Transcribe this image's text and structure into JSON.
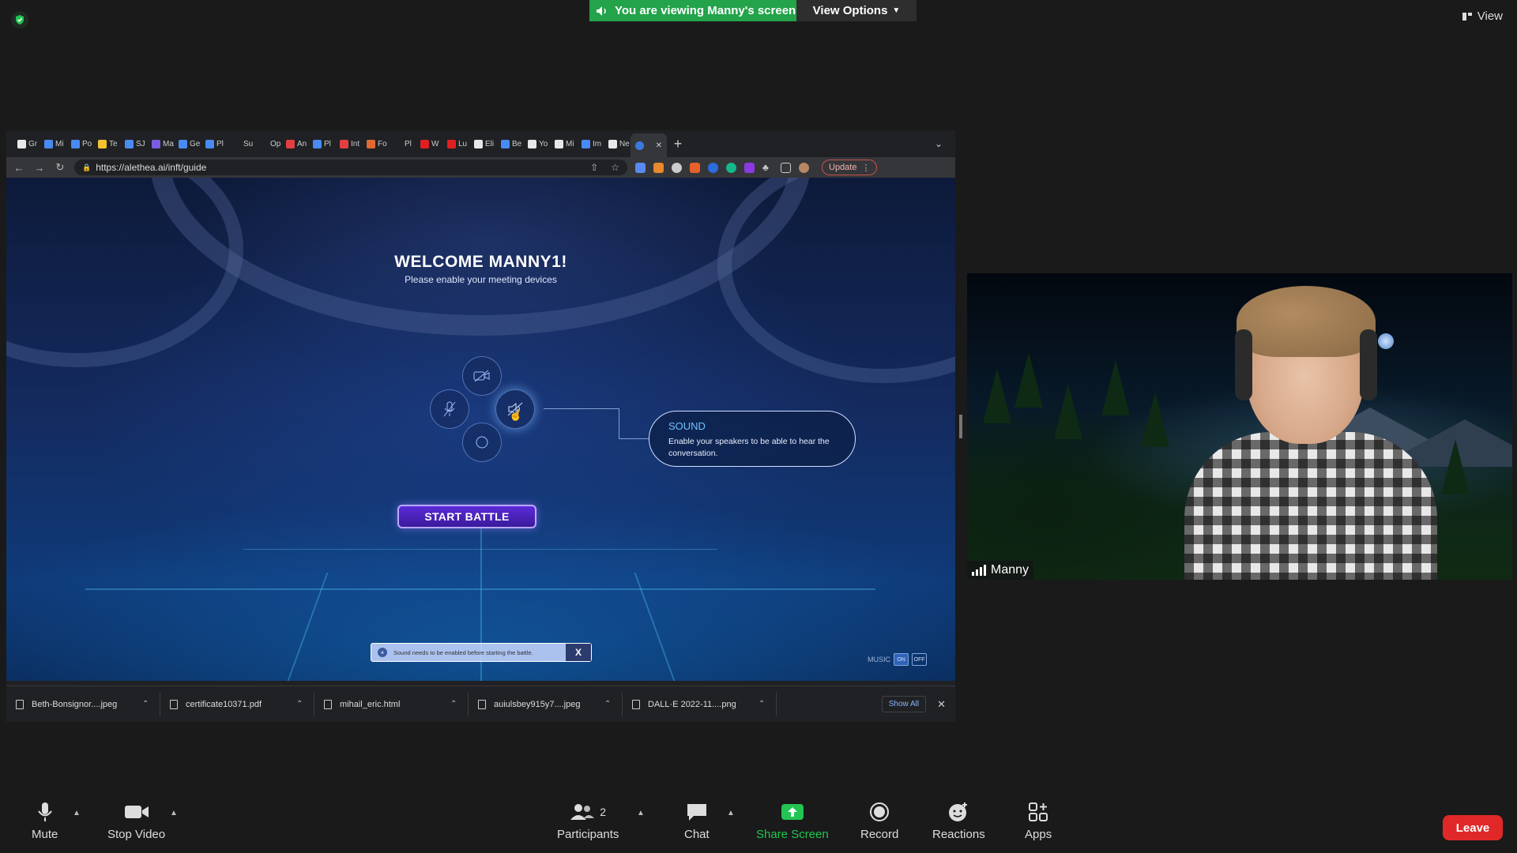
{
  "zoom": {
    "banner": "You are viewing Manny's screen",
    "view_options": "View Options",
    "view": "View",
    "participant_name": "Manny",
    "participant_count": "2",
    "toolbar": {
      "mute": "Mute",
      "stop_video": "Stop Video",
      "participants": "Participants",
      "chat": "Chat",
      "share_screen": "Share Screen",
      "record": "Record",
      "reactions": "Reactions",
      "apps": "Apps",
      "leave": "Leave"
    },
    "colors": {
      "banner": "#23a34a",
      "leave": "#e02828",
      "share": "#23c552"
    }
  },
  "browser": {
    "tabs": [
      {
        "label": "Gr",
        "color": "#e8e8e8"
      },
      {
        "label": "Mi",
        "color": "#4a8af4"
      },
      {
        "label": "Po",
        "color": "#4a8af4"
      },
      {
        "label": "Te",
        "color": "#f4c430"
      },
      {
        "label": "SJ",
        "color": "#4a8af4"
      },
      {
        "label": "Ma",
        "color": "#7a5ce0"
      },
      {
        "label": "Ge",
        "color": "#4a8af4"
      },
      {
        "label": "Pl",
        "color": "#4a8af4"
      },
      {
        "label": "Su",
        "color": "#202124"
      },
      {
        "label": "Op",
        "color": "#202124"
      },
      {
        "label": "An",
        "color": "#e04040"
      },
      {
        "label": "Pl",
        "color": "#4a8af4"
      },
      {
        "label": "Int",
        "color": "#e04040"
      },
      {
        "label": "Fo",
        "color": "#e06a30"
      },
      {
        "label": "Pl",
        "color": "#202124"
      },
      {
        "label": "W",
        "color": "#e02020"
      },
      {
        "label": "Lu",
        "color": "#e02020"
      },
      {
        "label": "Eli",
        "color": "#e8e8e8"
      },
      {
        "label": "Be",
        "color": "#4a8af4"
      },
      {
        "label": "Yo",
        "color": "#e8e8e8"
      },
      {
        "label": "Mi",
        "color": "#e8e8e8"
      },
      {
        "label": "Im",
        "color": "#4a8af4"
      },
      {
        "label": "Ne",
        "color": "#e8e8e8"
      }
    ],
    "url": "https://alethea.ai/inft/guide",
    "update_label": "Update",
    "downloads": [
      {
        "name": "Beth-Bonsignor....jpeg"
      },
      {
        "name": "certificate10371.pdf"
      },
      {
        "name": "mihail_eric.html"
      },
      {
        "name": "auiulsbey915y7....jpeg"
      },
      {
        "name": "DALL·E 2022-11....png"
      }
    ],
    "show_all": "Show All"
  },
  "game": {
    "welcome": "WELCOME MANNY1!",
    "subtitle": "Please enable your meeting devices",
    "sound_title": "SOUND",
    "sound_desc": "Enable your speakers to be able to hear the conversation.",
    "start_battle": "START BATTLE",
    "toast": "Sound needs to be enabled before starting the battle.",
    "toast_close": "X",
    "music_label": "MUSIC",
    "music_on": "ON",
    "music_off": "OFF"
  }
}
